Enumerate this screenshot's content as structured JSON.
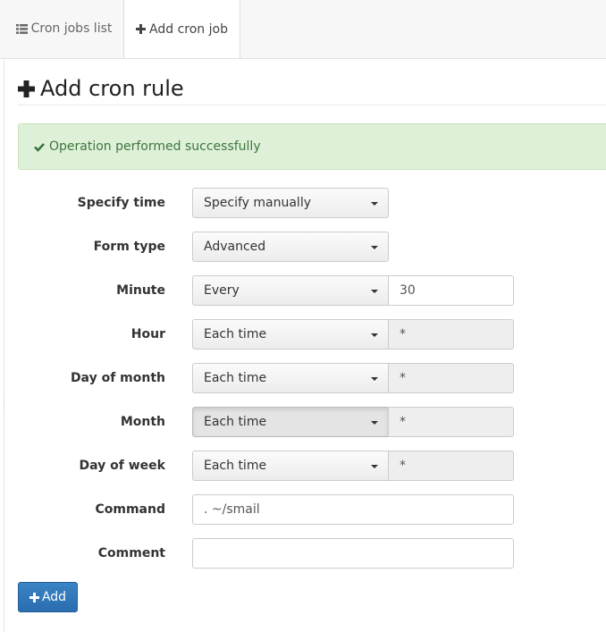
{
  "tabs": [
    {
      "label": "Cron jobs list",
      "icon": "list-icon",
      "active": false
    },
    {
      "label": "Add cron job",
      "icon": "plus-icon",
      "active": true
    }
  ],
  "page_title": "Add cron rule",
  "alert": {
    "text": "Operation performed successfully",
    "icon": "check-icon",
    "color": "#3c763d"
  },
  "form": {
    "specify_time": {
      "label": "Specify time",
      "value": "Specify manually"
    },
    "form_type": {
      "label": "Form type",
      "value": "Advanced"
    },
    "minute": {
      "label": "Minute",
      "mode": "Every",
      "value": "30"
    },
    "hour": {
      "label": "Hour",
      "mode": "Each time",
      "value": "*"
    },
    "day_of_month": {
      "label": "Day of month",
      "mode": "Each time",
      "value": "*"
    },
    "month": {
      "label": "Month",
      "mode": "Each time",
      "value": "*"
    },
    "day_of_week": {
      "label": "Day of week",
      "mode": "Each time",
      "value": "*"
    },
    "command": {
      "label": "Command",
      "value": ". ~/smail"
    },
    "comment": {
      "label": "Comment",
      "value": ""
    }
  },
  "add_button": {
    "label": "Add",
    "icon": "plus-icon",
    "color": "#337ab7"
  }
}
